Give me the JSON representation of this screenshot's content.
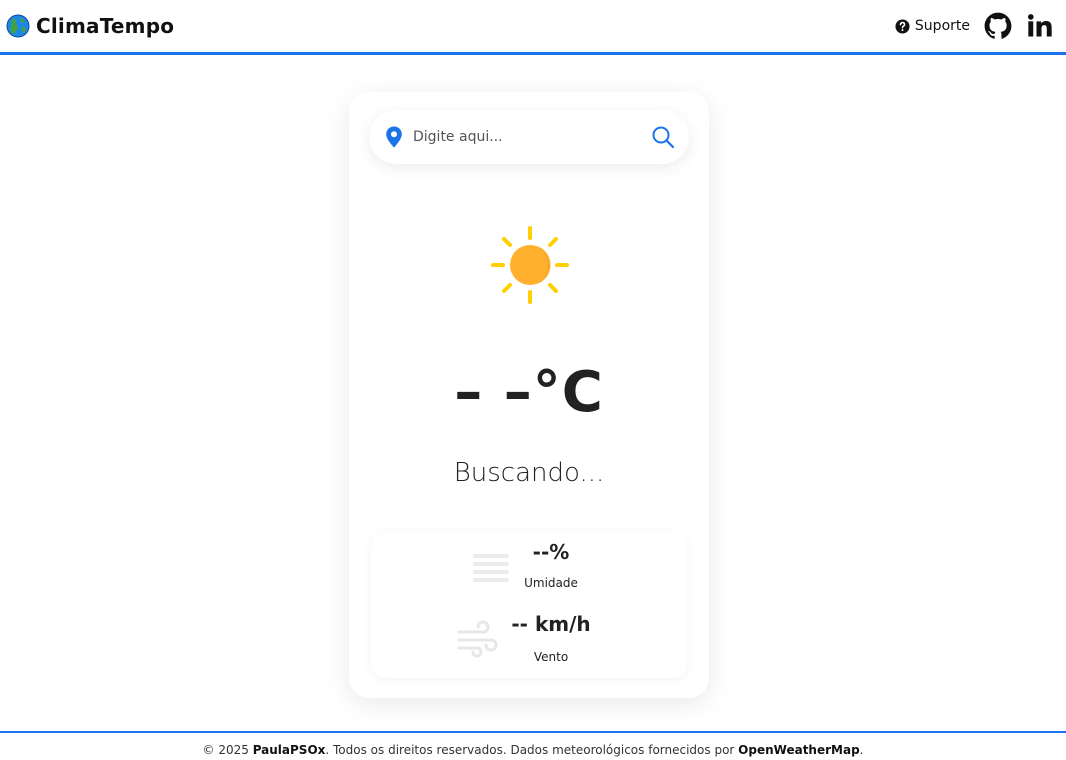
{
  "header": {
    "title": "ClimaTempo",
    "support_label": "Suporte",
    "logo_icon": "globe-icon",
    "github_icon": "github-icon",
    "linkedin_icon": "linkedin-icon",
    "accent_color": "#1a73e8"
  },
  "search": {
    "placeholder": "Digite aqui...",
    "value": ""
  },
  "weather": {
    "icon": "sun-icon",
    "temperature": "– –°C",
    "description": "Buscando..."
  },
  "details": {
    "humidity": {
      "value": "--%",
      "label": "Umidade",
      "icon": "humidity-icon"
    },
    "wind": {
      "value": "-- km/h",
      "label": "Vento",
      "icon": "wind-icon"
    }
  },
  "footer": {
    "prefix": "© 2025 ",
    "author": "PaulaPSOx",
    "middle": ". Todos os direitos reservados. Dados meteorológicos fornecidos por ",
    "provider": "OpenWeatherMap",
    "suffix": "."
  }
}
